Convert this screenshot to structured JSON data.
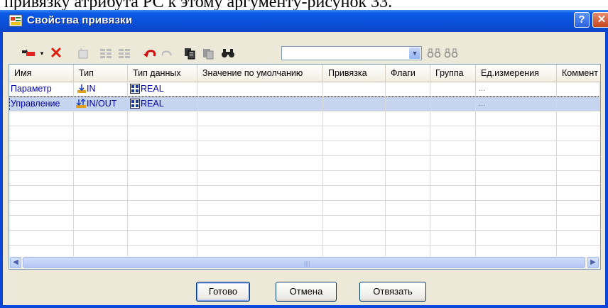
{
  "doc_text": "привязку атрибута РС к этому аргументу-рисунок 33.",
  "window": {
    "title": "Свойства привязки",
    "help_label": "?",
    "close_label": "✕"
  },
  "toolbar": {
    "search_value": ""
  },
  "table": {
    "headers": [
      "Имя",
      "Тип",
      "Тип данных",
      "Значение по умолчанию",
      "Привязка",
      "Флаги",
      "Группа",
      "Ед.измерения",
      "Коммент"
    ],
    "rows": [
      {
        "name": "Параметр",
        "type": "IN",
        "datatype": "REAL",
        "unit": "..."
      },
      {
        "name": "Управление",
        "type": "IN/OUT",
        "datatype": "REAL",
        "unit": "..."
      }
    ]
  },
  "buttons": {
    "ok": "Готово",
    "cancel": "Отмена",
    "unbind": "Отвязать"
  },
  "colors": {
    "titlebar": "#0a4fd8",
    "selection": "#c7d4ef",
    "cell_text": "#0000a8"
  }
}
